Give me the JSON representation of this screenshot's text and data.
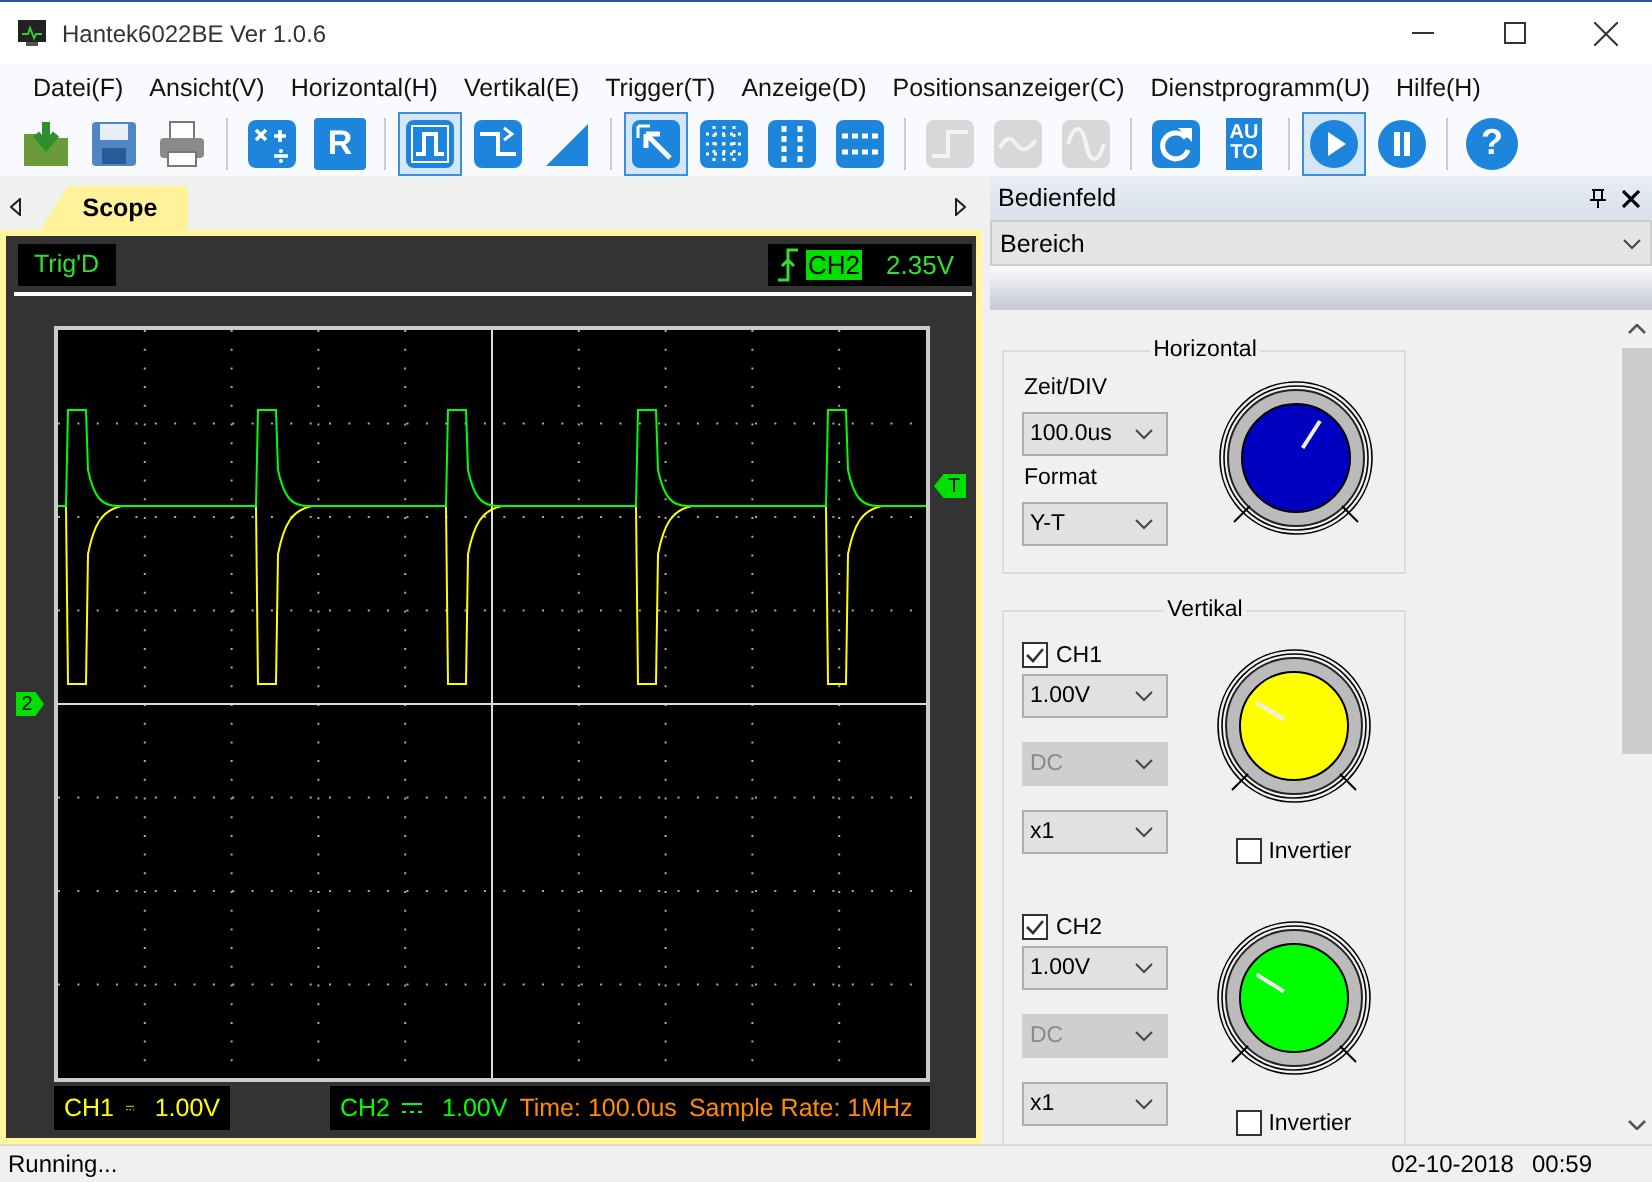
{
  "window": {
    "title": "Hantek6022BE Ver 1.0.6"
  },
  "menu": [
    "Datei(F)",
    "Ansicht(V)",
    "Horizontal(H)",
    "Vertikal(E)",
    "Trigger(T)",
    "Anzeige(D)",
    "Positionsanzeiger(C)",
    "Dienstprogramm(U)",
    "Hilfe(H)"
  ],
  "toolbar": [
    [
      {
        "kind": "open",
        "selected": false,
        "disabled": false
      },
      {
        "kind": "save",
        "selected": false,
        "disabled": false
      },
      {
        "kind": "print",
        "selected": false,
        "disabled": false
      }
    ],
    [
      {
        "kind": "math",
        "selected": false,
        "disabled": false
      },
      {
        "kind": "reference",
        "label": "R",
        "selected": false,
        "disabled": false
      }
    ],
    [
      {
        "kind": "pulse",
        "selected": true,
        "disabled": false
      },
      {
        "kind": "measure",
        "selected": false,
        "disabled": false
      },
      {
        "kind": "trend",
        "selected": false,
        "disabled": false
      }
    ],
    [
      {
        "kind": "cursor",
        "selected": true,
        "disabled": false
      },
      {
        "kind": "grid",
        "selected": false,
        "disabled": false
      },
      {
        "kind": "vcursor",
        "selected": false,
        "disabled": false
      },
      {
        "kind": "hcursor",
        "selected": false,
        "disabled": false
      }
    ],
    [
      {
        "kind": "step",
        "selected": false,
        "disabled": true
      },
      {
        "kind": "wave",
        "selected": false,
        "disabled": true
      },
      {
        "kind": "sine",
        "selected": false,
        "disabled": true
      }
    ],
    [
      {
        "kind": "refresh",
        "selected": false,
        "disabled": false
      },
      {
        "kind": "auto",
        "label": "AUTO",
        "selected": false,
        "disabled": false
      }
    ],
    [
      {
        "kind": "play",
        "selected": true,
        "disabled": false
      },
      {
        "kind": "pause",
        "selected": false,
        "disabled": false
      }
    ],
    [
      {
        "kind": "help",
        "label": "?",
        "selected": false,
        "disabled": false
      }
    ]
  ],
  "scope": {
    "tabs": [
      {
        "label": "Scope",
        "selected": true
      }
    ],
    "status": "Trig'D",
    "trigger": {
      "source": "CH2",
      "level": "2.35V"
    },
    "trigger_marker": "T",
    "channel_marker": "2",
    "readouts": [
      {
        "kind": "channel",
        "label": "CH1",
        "value": "1.00V",
        "color": "#ffff00"
      },
      {
        "kind": "channel",
        "label": "CH2",
        "value": "1.00V",
        "color": "#00ff00"
      },
      {
        "kind": "info",
        "text": "Time: 100.0us",
        "color": "#ff8c00"
      },
      {
        "kind": "info",
        "text": "Sample Rate: 1MHz",
        "color": "#ff8c00"
      }
    ]
  },
  "panel": {
    "title": "Bedienfeld",
    "section": "Bereich",
    "horizontal": {
      "title": "Horizontal",
      "fields": [
        {
          "label": "Zeit/DIV",
          "value": "100.0us"
        },
        {
          "label": "Format",
          "value": "Y-T"
        }
      ]
    },
    "vertical": {
      "title": "Vertikal",
      "channels": [
        {
          "name": "CH1",
          "checked": true,
          "volts": "1.00V",
          "coupling": "DC",
          "coupling_disabled": true,
          "probe": "x1",
          "invert": "Invertier",
          "inverted": false,
          "color": "#ffff00"
        },
        {
          "name": "CH2",
          "checked": true,
          "volts": "1.00V",
          "coupling": "DC",
          "coupling_disabled": true,
          "probe": "x1",
          "invert": "Invertier",
          "inverted": false,
          "color": "#00ff00"
        }
      ]
    }
  },
  "status_bar": {
    "text": "Running...",
    "date": "02-10-2018",
    "time": "00:59"
  }
}
